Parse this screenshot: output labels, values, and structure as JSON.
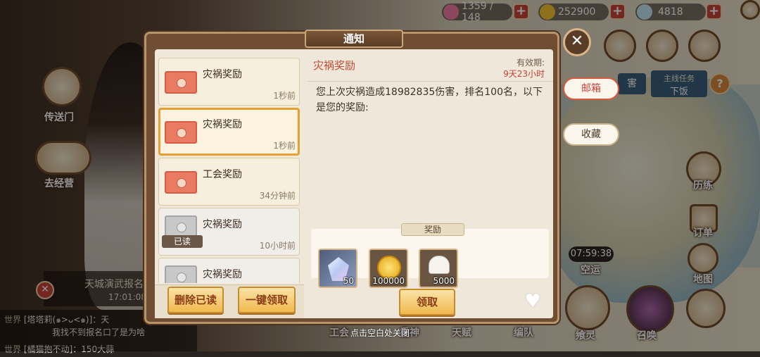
{
  "hud": {
    "stamina": "1359 / 148",
    "gold": "252900",
    "gems": "4818"
  },
  "left_labels": {
    "teleport": "传送门",
    "back": "去经营"
  },
  "notice_panel": {
    "title": "天城演武报名",
    "time": "17:01:08"
  },
  "chat": [
    {
      "channel": "世界",
      "text": "[塔塔莉(๑>ᴗ<๑)]：天"
    },
    {
      "channel": "",
      "text": "我找不到报名口了是为啥"
    },
    {
      "channel": "世界",
      "text": "[橘猫抱不动]：150大蒜"
    }
  ],
  "dialog": {
    "title": "通知",
    "mails": [
      {
        "title": "灾祸奖励",
        "time": "1秒前",
        "read": false,
        "selected": false
      },
      {
        "title": "灾祸奖励",
        "time": "1秒前",
        "read": false,
        "selected": true
      },
      {
        "title": "工会奖励",
        "time": "34分钟前",
        "read": false,
        "selected": false
      },
      {
        "title": "灾祸奖励",
        "time": "10小时前",
        "read": true,
        "selected": false
      },
      {
        "title": "灾祸奖励",
        "time": "",
        "read": true,
        "selected": false
      }
    ],
    "read_badge": "已读",
    "delete_read_label": "删除已读",
    "claim_all_label": "一键领取",
    "detail": {
      "title": "灾祸奖励",
      "validity_label": "有效期:",
      "validity_value": "9天23小时",
      "body": "您上次灾祸造成18982835伤害，排名100名，以下是您的奖励:",
      "reward_title": "奖励",
      "rewards": [
        {
          "icon": "crystal-icon",
          "qty": "50"
        },
        {
          "icon": "gold-coin-icon",
          "qty": "100000"
        },
        {
          "icon": "chef-hat-icon",
          "qty": "5000"
        }
      ],
      "claim_label": "领取"
    }
  },
  "side_tabs": {
    "mailbox": "邮箱",
    "favorites": "收藏"
  },
  "right_labels": {
    "task": "主线任务",
    "task_sub": "下饭",
    "timer": "07:59:38",
    "ship": "空运",
    "order": "订单",
    "map": "地图",
    "training": "历练",
    "spirit": "飨灵",
    "summon": "召唤",
    "harm": "害"
  },
  "bottom_labels": {
    "talent": "天赋",
    "team": "编队",
    "work": "工会",
    "god": "重神"
  },
  "close_hint": "点击空白处关闭",
  "colors": {
    "accent_red": "#c24a34",
    "button_gold": "#f0b94e",
    "selected_border": "#e5a030"
  }
}
